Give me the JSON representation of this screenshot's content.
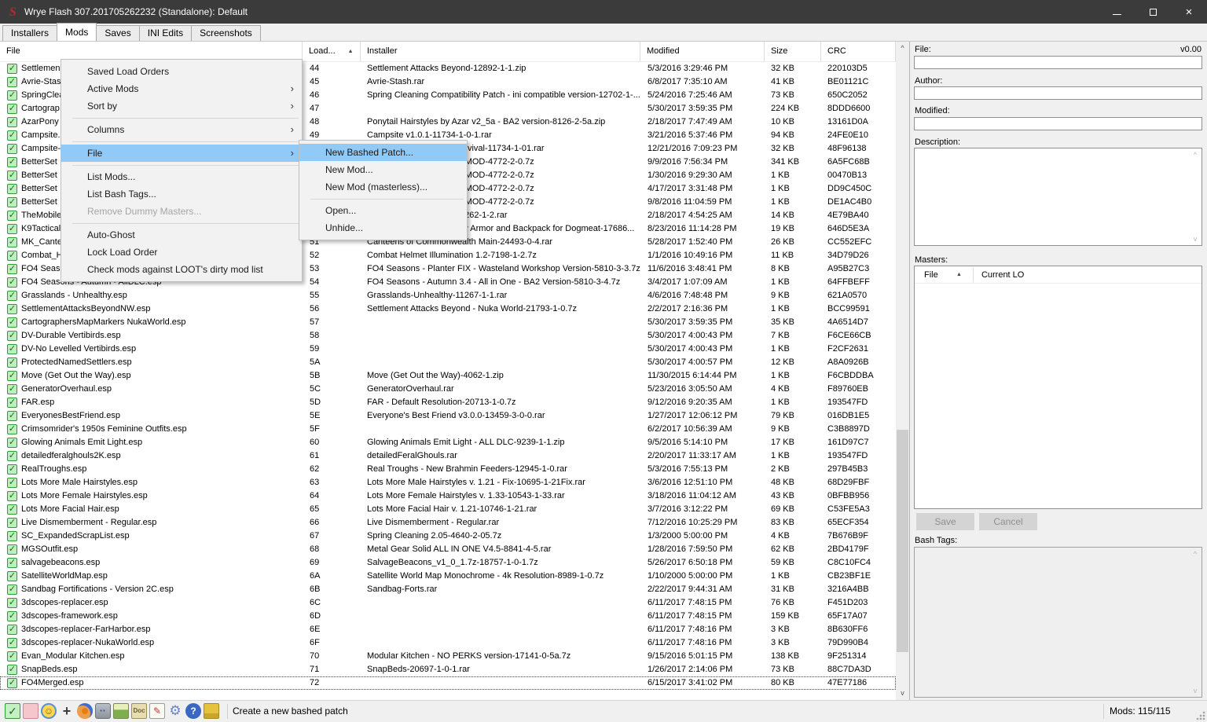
{
  "window": {
    "title": "Wrye Flash 307.201705262232 (Standalone): Default"
  },
  "tabs": [
    {
      "label": "Installers",
      "active": false
    },
    {
      "label": "Mods",
      "active": true
    },
    {
      "label": "Saves",
      "active": false
    },
    {
      "label": "INI Edits",
      "active": false
    },
    {
      "label": "Screenshots",
      "active": false
    }
  ],
  "mod_table": {
    "columns": [
      "File",
      "Load...",
      "Installer",
      "Modified",
      "Size",
      "CRC"
    ],
    "rows": [
      {
        "file": "Settlemen",
        "load": "44",
        "installer": "Settlement Attacks Beyond-12892-1-1.zip",
        "modified": "5/3/2016 3:29:46 PM",
        "size": "32 KB",
        "crc": "220103D5"
      },
      {
        "file": "Avrie-Stas",
        "load": "45",
        "installer": "Avrie-Stash.rar",
        "modified": "6/8/2017 7:35:10 AM",
        "size": "41 KB",
        "crc": "BE01121C"
      },
      {
        "file": "SpringClea",
        "load": "46",
        "installer": "Spring Cleaning Compatibility Patch - ini compatible version-12702-1-...",
        "modified": "5/24/2016 7:25:46 AM",
        "size": "73 KB",
        "crc": "650C2052"
      },
      {
        "file": "Cartograp",
        "load": "47",
        "installer": "",
        "modified": "5/30/2017 3:59:35 PM",
        "size": "224 KB",
        "crc": "8DDD6600"
      },
      {
        "file": "AzarPony",
        "load": "48",
        "installer": "Ponytail Hairstyles by Azar v2_5a - BA2 version-8126-2-5a.zip",
        "modified": "2/18/2017 7:47:49 AM",
        "size": "10 KB",
        "crc": "13161D0A"
      },
      {
        "file": "Campsite.",
        "load": "49",
        "installer": "Campsite v1.0.1-11734-1-0-1.rar",
        "modified": "3/21/2016 5:37:46 PM",
        "size": "94 KB",
        "crc": "24FE0E10"
      },
      {
        "file": "Campsite-",
        "load": "4A",
        "installer": "Campsite - Wasteland Survival-11734-1-01.rar",
        "modified": "12/21/2016 7:09:23 PM",
        "size": "32 KB",
        "crc": "48F96138"
      },
      {
        "file": "BetterSet",
        "load": "4B",
        "installer": "Better Settlers Master FOMOD-4772-2-0.7z",
        "modified": "9/9/2016 7:56:34 PM",
        "size": "341 KB",
        "crc": "6A5FC68B"
      },
      {
        "file": "BetterSet",
        "load": "4C",
        "installer": "Better Settlers Master FOMOD-4772-2-0.7z",
        "modified": "1/30/2016 9:29:30 AM",
        "size": "1 KB",
        "crc": "00470B13"
      },
      {
        "file": "BetterSet",
        "load": "4D",
        "installer": "Better Settlers Master FOMOD-4772-2-0.7z",
        "modified": "4/17/2017 3:31:48 PM",
        "size": "1 KB",
        "crc": "DD9C450C"
      },
      {
        "file": "BetterSet",
        "load": "4E",
        "installer": "Better Settlers Master FOMOD-4772-2-0.7z",
        "modified": "9/8/2016 11:04:59 PM",
        "size": "1 KB",
        "crc": "DE1AC4B0"
      },
      {
        "file": "TheMobile",
        "load": "4F",
        "installer": "Mobile Mechanic Beta-18262-1-2.rar",
        "modified": "2/18/2017 4:54:25 AM",
        "size": "14 KB",
        "crc": "4E79BA40"
      },
      {
        "file": "K9Tactical",
        "load": "50",
        "installer": "K-9 Harness Tactical Body Armor and Backpack for Dogmeat-17686...",
        "modified": "8/23/2016 11:14:28 PM",
        "size": "19 KB",
        "crc": "646D5E3A"
      },
      {
        "file": "MK_Cante",
        "load": "51",
        "installer": "Canteens of Commonwealth Main-24493-0-4.rar",
        "modified": "5/28/2017 1:52:40 PM",
        "size": "26 KB",
        "crc": "CC552EFC"
      },
      {
        "file": "Combat_H",
        "load": "52",
        "installer": "Combat Helmet Illumination 1.2-7198-1-2.7z",
        "modified": "1/1/2016 10:49:16 PM",
        "size": "11 KB",
        "crc": "34D79D26"
      },
      {
        "file": "FO4 Seas",
        "load": "53",
        "installer": "FO4 Seasons - Planter FIX - Wasteland Workshop Version-5810-3-3.7z",
        "modified": "11/6/2016 3:48:41 PM",
        "size": "8 KB",
        "crc": "A95B27C3"
      },
      {
        "file": "FO4 Seasons - Autumn - AllDLC.esp",
        "load": "54",
        "installer": "FO4 Seasons - Autumn 3.4 - All in One - BA2 Version-5810-3-4.7z",
        "modified": "3/4/2017 1:07:09 AM",
        "size": "1 KB",
        "crc": "64FFBEFF"
      },
      {
        "file": "Grasslands - Unhealthy.esp",
        "load": "55",
        "installer": "Grasslands-Unhealthy-11267-1-1.rar",
        "modified": "4/6/2016 7:48:48 PM",
        "size": "9 KB",
        "crc": "621A0570"
      },
      {
        "file": "SettlementAttacksBeyondNW.esp",
        "load": "56",
        "installer": "Settlement Attacks Beyond - Nuka World-21793-1-0.7z",
        "modified": "2/2/2017 2:16:36 PM",
        "size": "1 KB",
        "crc": "BCC99591"
      },
      {
        "file": "CartographersMapMarkers NukaWorld.esp",
        "load": "57",
        "installer": "",
        "modified": "5/30/2017 3:59:35 PM",
        "size": "35 KB",
        "crc": "4A6514D7"
      },
      {
        "file": "DV-Durable Vertibirds.esp",
        "load": "58",
        "installer": "",
        "modified": "5/30/2017 4:00:43 PM",
        "size": "7 KB",
        "crc": "F6CE66CB"
      },
      {
        "file": "DV-No Levelled Vertibirds.esp",
        "load": "59",
        "installer": "",
        "modified": "5/30/2017 4:00:43 PM",
        "size": "1 KB",
        "crc": "F2CF2631"
      },
      {
        "file": "ProtectedNamedSettlers.esp",
        "load": "5A",
        "installer": "",
        "modified": "5/30/2017 4:00:57 PM",
        "size": "12 KB",
        "crc": "A8A0926B"
      },
      {
        "file": "Move (Get Out the Way).esp",
        "load": "5B",
        "installer": "Move (Get Out the Way)-4062-1.zip",
        "modified": "11/30/2015 6:14:44 PM",
        "size": "1 KB",
        "crc": "F6CBDDBA"
      },
      {
        "file": "GeneratorOverhaul.esp",
        "load": "5C",
        "installer": "GeneratorOverhaul.rar",
        "modified": "5/23/2016 3:05:50 AM",
        "size": "4 KB",
        "crc": "F89760EB"
      },
      {
        "file": "FAR.esp",
        "load": "5D",
        "installer": "FAR - Default Resolution-20713-1-0.7z",
        "modified": "9/12/2016 9:20:35 AM",
        "size": "1 KB",
        "crc": "193547FD"
      },
      {
        "file": "EveryonesBestFriend.esp",
        "load": "5E",
        "installer": "Everyone's Best Friend v3.0.0-13459-3-0-0.rar",
        "modified": "1/27/2017 12:06:12 PM",
        "size": "79 KB",
        "crc": "016DB1E5"
      },
      {
        "file": "Crimsomrider's 1950s Feminine Outfits.esp",
        "load": "5F",
        "installer": "",
        "modified": "6/2/2017 10:56:39 AM",
        "size": "9 KB",
        "crc": "C3B8897D"
      },
      {
        "file": "Glowing Animals Emit Light.esp",
        "load": "60",
        "installer": "Glowing Animals Emit Light - ALL DLC-9239-1-1.zip",
        "modified": "9/5/2016 5:14:10 PM",
        "size": "17 KB",
        "crc": "161D97C7"
      },
      {
        "file": "detailedferalghouls2K.esp",
        "load": "61",
        "installer": "detailedFeralGhouls.rar",
        "modified": "2/20/2017 11:33:17 AM",
        "size": "1 KB",
        "crc": "193547FD"
      },
      {
        "file": "RealTroughs.esp",
        "load": "62",
        "installer": "Real Troughs - New Brahmin Feeders-12945-1-0.rar",
        "modified": "5/3/2016 7:55:13 PM",
        "size": "2 KB",
        "crc": "297B45B3"
      },
      {
        "file": "Lots More Male Hairstyles.esp",
        "load": "63",
        "installer": "Lots More Male Hairstyles v. 1.21 - Fix-10695-1-21Fix.rar",
        "modified": "3/6/2016 12:51:10 PM",
        "size": "48 KB",
        "crc": "68D29FBF"
      },
      {
        "file": "Lots More Female Hairstyles.esp",
        "load": "64",
        "installer": "Lots More Female Hairstyles v. 1.33-10543-1-33.rar",
        "modified": "3/18/2016 11:04:12 AM",
        "size": "43 KB",
        "crc": "0BFBB956"
      },
      {
        "file": "Lots More Facial Hair.esp",
        "load": "65",
        "installer": "Lots More Facial Hair v. 1.21-10746-1-21.rar",
        "modified": "3/7/2016 3:12:22 PM",
        "size": "69 KB",
        "crc": "C53FE5A3"
      },
      {
        "file": "Live Dismemberment - Regular.esp",
        "load": "66",
        "installer": "Live Dismemberment - Regular.rar",
        "modified": "7/12/2016 10:25:29 PM",
        "size": "83 KB",
        "crc": "65ECF354"
      },
      {
        "file": "SC_ExpandedScrapList.esp",
        "load": "67",
        "installer": "Spring Cleaning 2.05-4640-2-05.7z",
        "modified": "1/3/2000 5:00:00 PM",
        "size": "4 KB",
        "crc": "7B676B9F"
      },
      {
        "file": "MGSOutfit.esp",
        "load": "68",
        "installer": "Metal Gear Solid ALL IN ONE V4.5-8841-4-5.rar",
        "modified": "1/28/2016 7:59:50 PM",
        "size": "62 KB",
        "crc": "2BD4179F"
      },
      {
        "file": "salvagebeacons.esp",
        "load": "69",
        "installer": "SalvageBeacons_v1_0_1.7z-18757-1-0-1.7z",
        "modified": "5/26/2017 6:50:18 PM",
        "size": "59 KB",
        "crc": "C8C10FC4"
      },
      {
        "file": "SatelliteWorldMap.esp",
        "load": "6A",
        "installer": "Satellite World Map Monochrome - 4k Resolution-8989-1-0.7z",
        "modified": "1/10/2000 5:00:00 PM",
        "size": "1 KB",
        "crc": "CB23BF1E"
      },
      {
        "file": "Sandbag Fortifications - Version 2C.esp",
        "load": "6B",
        "installer": "Sandbag-Forts.rar",
        "modified": "2/22/2017 9:44:31 AM",
        "size": "31 KB",
        "crc": "3216A4BB"
      },
      {
        "file": "3dscopes-replacer.esp",
        "load": "6C",
        "installer": "",
        "modified": "6/11/2017 7:48:15 PM",
        "size": "76 KB",
        "crc": "F451D203"
      },
      {
        "file": "3dscopes-framework.esp",
        "load": "6D",
        "installer": "",
        "modified": "6/11/2017 7:48:15 PM",
        "size": "159 KB",
        "crc": "65F17A07"
      },
      {
        "file": "3dscopes-replacer-FarHarbor.esp",
        "load": "6E",
        "installer": "",
        "modified": "6/11/2017 7:48:16 PM",
        "size": "3 KB",
        "crc": "8B630FF6"
      },
      {
        "file": "3dscopes-replacer-NukaWorld.esp",
        "load": "6F",
        "installer": "",
        "modified": "6/11/2017 7:48:16 PM",
        "size": "3 KB",
        "crc": "79D990B4"
      },
      {
        "file": "Evan_Modular Kitchen.esp",
        "load": "70",
        "installer": "Modular Kitchen - NO PERKS version-17141-0-5a.7z",
        "modified": "9/15/2016 5:01:15 PM",
        "size": "138 KB",
        "crc": "9F251314"
      },
      {
        "file": "SnapBeds.esp",
        "load": "71",
        "installer": "SnapBeds-20697-1-0-1.rar",
        "modified": "1/26/2017 2:14:06 PM",
        "size": "73 KB",
        "crc": "88C7DA3D"
      },
      {
        "file": "FO4Merged.esp",
        "load": "72",
        "installer": "",
        "modified": "6/15/2017 3:41:02 PM",
        "size": "80 KB",
        "crc": "47E77186",
        "selected": true
      }
    ]
  },
  "context_menu": {
    "items": [
      {
        "label": "Saved Load Orders"
      },
      {
        "label": "Active Mods",
        "submenu": true
      },
      {
        "label": "Sort by",
        "submenu": true
      },
      {
        "separator": true
      },
      {
        "label": "Columns",
        "submenu": true
      },
      {
        "separator": true
      },
      {
        "label": "File",
        "submenu": true,
        "highlighted": true
      },
      {
        "separator": true
      },
      {
        "label": "List Mods..."
      },
      {
        "label": "List Bash Tags..."
      },
      {
        "label": "Remove Dummy Masters...",
        "disabled": true
      },
      {
        "separator": true
      },
      {
        "label": "Auto-Ghost"
      },
      {
        "label": "Lock Load Order"
      },
      {
        "label": "Check mods against LOOT's dirty mod list"
      }
    ]
  },
  "file_submenu": {
    "items": [
      {
        "label": "New Bashed Patch...",
        "highlighted": true
      },
      {
        "label": "New Mod..."
      },
      {
        "label": "New Mod (masterless)..."
      },
      {
        "separator": true
      },
      {
        "label": "Open..."
      },
      {
        "label": "Unhide..."
      }
    ]
  },
  "details_panel": {
    "file_label": "File:",
    "version": "v0.00",
    "author_label": "Author:",
    "modified_label": "Modified:",
    "description_label": "Description:",
    "masters_label": "Masters:",
    "masters_columns": [
      "File",
      "Current LO"
    ],
    "save_label": "Save",
    "cancel_label": "Cancel",
    "bash_tags_label": "Bash Tags:"
  },
  "status_bar": {
    "icons": [
      {
        "name": "checked-checkbox-icon",
        "glyph": "✓"
      },
      {
        "name": "unchecked-checkbox-icon",
        "glyph": ""
      },
      {
        "name": "vault-boy-icon",
        "glyph": "☺"
      },
      {
        "name": "launcher-icon",
        "glyph": "+"
      },
      {
        "name": "blender-icon",
        "glyph": ""
      },
      {
        "name": "robot-icon",
        "glyph": "▪▪"
      },
      {
        "name": "image-editor-icon",
        "glyph": ""
      },
      {
        "name": "doc-browser-icon",
        "glyph": "Doc"
      },
      {
        "name": "mod-checker-icon",
        "glyph": "✎"
      },
      {
        "name": "settings-gear-icon",
        "glyph": "⚙"
      },
      {
        "name": "help-icon",
        "glyph": "?"
      },
      {
        "name": "bashmon-icon",
        "glyph": ""
      }
    ],
    "message": "Create a new bashed patch",
    "mods_count": "Mods: 115/115"
  }
}
